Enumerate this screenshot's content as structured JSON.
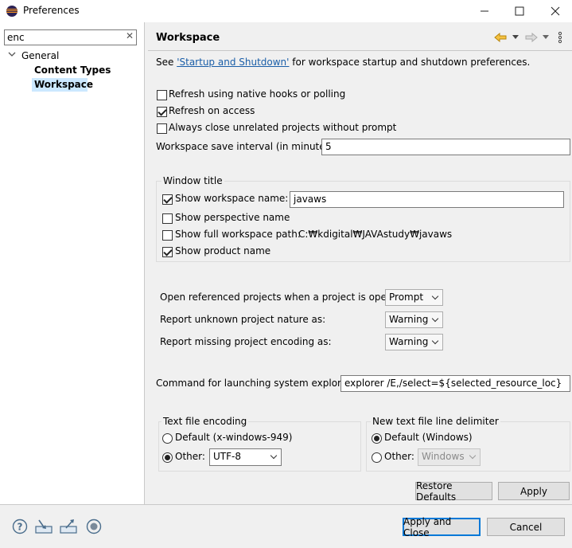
{
  "window": {
    "title": "Preferences",
    "controls": {
      "minimize": "—",
      "maximize": "☐",
      "close": "✕"
    }
  },
  "sidebar": {
    "filter_value": "enc",
    "clear_icon": "✕",
    "tree": {
      "root_label": "General",
      "children": [
        "Content Types",
        "Workspace"
      ],
      "selected": "Workspace"
    }
  },
  "page": {
    "title": "Workspace",
    "intro": {
      "prefix": "See ",
      "link": "'Startup and Shutdown'",
      "suffix": " for workspace startup and shutdown preferences."
    },
    "options": {
      "refresh_native": {
        "label": "Refresh using native hooks or polling",
        "checked": false
      },
      "refresh_access": {
        "label": "Refresh on access",
        "checked": true
      },
      "close_unrelated": {
        "label": "Always close unrelated projects without prompt",
        "checked": false
      }
    },
    "save_interval": {
      "label": "Workspace save interval (in minutes):",
      "value": "5"
    },
    "window_title": {
      "group_label": "Window title",
      "show_workspace_name": {
        "label": "Show workspace name:",
        "checked": true,
        "value": "javaws"
      },
      "show_perspective": {
        "label": "Show perspective name",
        "checked": false
      },
      "show_full_path": {
        "label": "Show full workspace path:",
        "checked": false,
        "value": "C:₩kdigital₩JAVAstudy₩javaws"
      },
      "show_product": {
        "label": "Show product name",
        "checked": true
      }
    },
    "referenced_projects": {
      "label": "Open referenced projects when a project is opened:",
      "value": "Prompt"
    },
    "unknown_nature": {
      "label": "Report unknown project nature as:",
      "value": "Warning"
    },
    "missing_encoding": {
      "label": "Report missing project encoding as:",
      "value": "Warning"
    },
    "system_explorer": {
      "label": "Command for launching system explorer:",
      "value": "explorer /E,/select=${selected_resource_loc}"
    },
    "text_encoding": {
      "group_label": "Text file encoding",
      "default_label": "Default (x-windows-949)",
      "other_label": "Other:",
      "other_value": "UTF-8",
      "selected": "other"
    },
    "line_delimiter": {
      "group_label": "New text file line delimiter",
      "default_label": "Default (Windows)",
      "other_label": "Other:",
      "other_value": "Windows",
      "selected": "default"
    },
    "restore_defaults_label": "Restore Defaults",
    "apply_label": "Apply"
  },
  "footer": {
    "icons": [
      "help-icon",
      "import-icon",
      "export-icon",
      "record-icon"
    ],
    "apply_close_label": "Apply and Close",
    "cancel_label": "Cancel"
  },
  "colors": {
    "selection": "#cce8ff",
    "link": "#1a5ea8",
    "default_button_border": "#0078d7",
    "eclipse_purple": "#2c2255",
    "eclipse_orange": "#f7941e"
  }
}
